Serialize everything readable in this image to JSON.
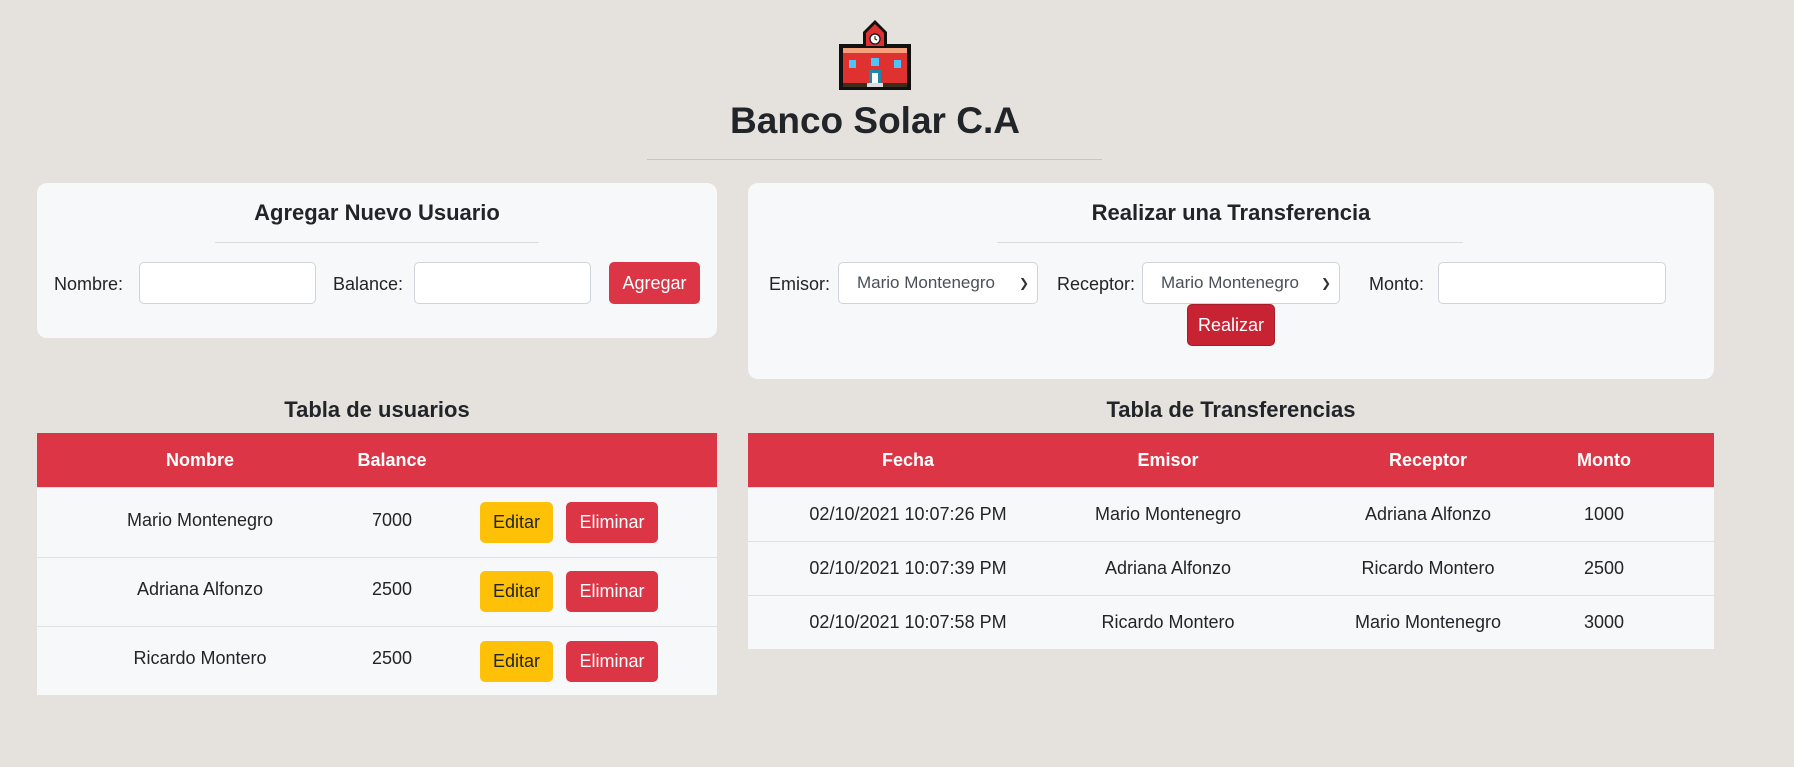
{
  "header": {
    "title": "Banco Solar C.A",
    "logo_icon": "school-building-icon"
  },
  "add_user": {
    "title": "Agregar Nuevo Usuario",
    "nombre_label": "Nombre:",
    "nombre_value": "",
    "balance_label": "Balance:",
    "balance_value": "",
    "submit_label": "Agregar"
  },
  "transfer": {
    "title": "Realizar una Transferencia",
    "emisor_label": "Emisor:",
    "emisor_value": "Mario Montenegro",
    "receptor_label": "Receptor:",
    "receptor_value": "Mario Montenegro",
    "monto_label": "Monto:",
    "monto_value": "",
    "submit_label": "Realizar"
  },
  "users_table": {
    "title": "Tabla de usuarios",
    "headers": [
      "Nombre",
      "Balance"
    ],
    "edit_label": "Editar",
    "delete_label": "Eliminar",
    "rows": [
      {
        "nombre": "Mario Montenegro",
        "balance": "7000"
      },
      {
        "nombre": "Adriana Alfonzo",
        "balance": "2500"
      },
      {
        "nombre": "Ricardo Montero",
        "balance": "2500"
      }
    ]
  },
  "transfers_table": {
    "title": "Tabla de Transferencias",
    "headers": [
      "Fecha",
      "Emisor",
      "Receptor",
      "Monto"
    ],
    "rows": [
      {
        "fecha": "02/10/2021 10:07:26 PM",
        "emisor": "Mario Montenegro",
        "receptor": "Adriana Alfonzo",
        "monto": "1000"
      },
      {
        "fecha": "02/10/2021 10:07:39 PM",
        "emisor": "Adriana Alfonzo",
        "receptor": "Ricardo Montero",
        "monto": "2500"
      },
      {
        "fecha": "02/10/2021 10:07:58 PM",
        "emisor": "Ricardo Montero",
        "receptor": "Mario Montenegro",
        "monto": "3000"
      }
    ]
  },
  "colors": {
    "background": "#e5e2dd",
    "card": "#f7f8f9",
    "danger": "#dc3545",
    "warning": "#ffc107"
  }
}
